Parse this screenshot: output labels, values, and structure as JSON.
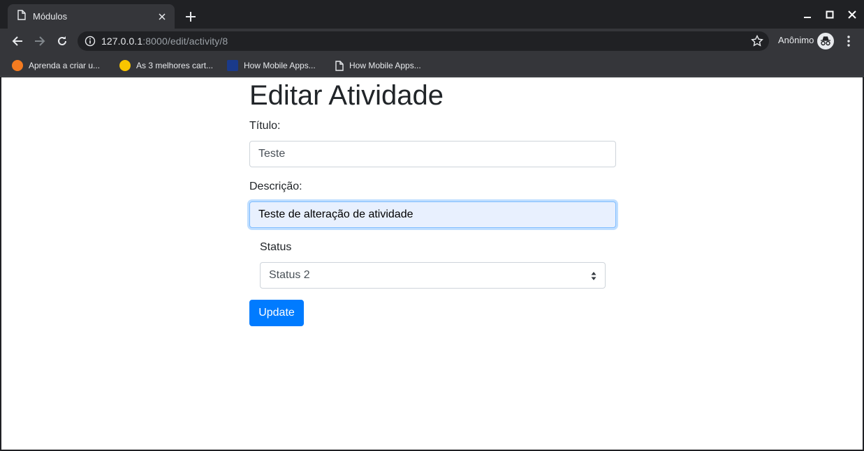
{
  "browser": {
    "tab_title": "Módulos",
    "url_host": "127.0.0.1",
    "url_rest": ":8000/edit/activity/8",
    "profile_label": "Anônimo",
    "bookmarks": [
      {
        "label": "Aprenda a criar u...",
        "color": "#f47b20"
      },
      {
        "label": "As 3 melhores cart...",
        "color": "#f9c500"
      },
      {
        "label": "How Mobile Apps...",
        "color": "#1a3a8a"
      },
      {
        "label": "How Mobile Apps...",
        "color": "#e8eaed"
      }
    ]
  },
  "form": {
    "heading": "Editar Atividade",
    "title_label": "Título:",
    "title_value": "Teste",
    "description_label": "Descrição:",
    "description_value": "Teste de alteração de atividade",
    "status_label": "Status",
    "status_value": "Status 2",
    "submit_label": "Update"
  },
  "colors": {
    "primary": "#007bff",
    "chrome_dark": "#202124",
    "chrome_mid": "#35363a"
  }
}
